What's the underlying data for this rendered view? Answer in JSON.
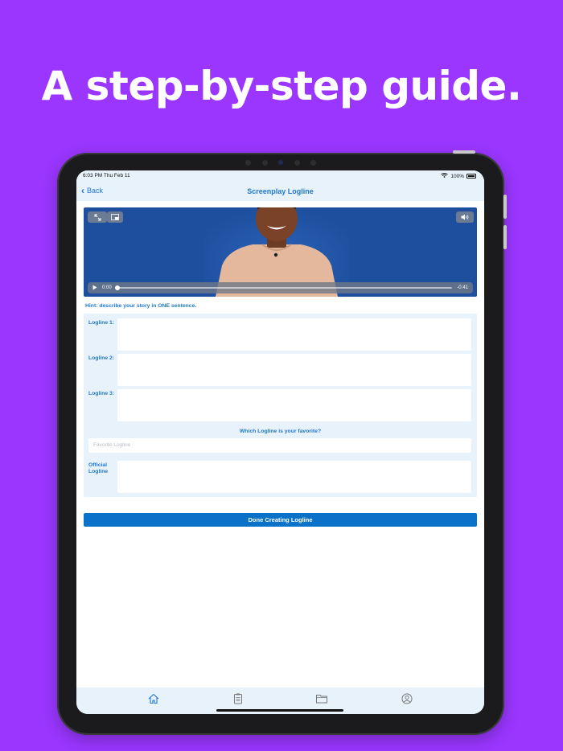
{
  "headline": "A step-by-step guide.",
  "status_bar": {
    "time": "6:03 PM  Thu Feb 11",
    "battery": "100%"
  },
  "nav": {
    "back_label": "Back",
    "title": "Screenplay Logline"
  },
  "video": {
    "current_time": "0:00",
    "remaining_time": "-0:41",
    "progress": 0.0
  },
  "hint": "Hint: describe your story in ONE sentence.",
  "form": {
    "logline_1_label": "Logline 1:",
    "logline_2_label": "Logline 2:",
    "logline_3_label": "Logline 3:",
    "favorite_question": "Which Logline is your favorite?",
    "favorite_placeholder": "Favorite Logline",
    "official_label_line1": "Official",
    "official_label_line2": "Logline"
  },
  "done_button": "Done Creating Logline",
  "tabbar": {
    "items": [
      "home-icon",
      "clipboard-icon",
      "folder-icon",
      "profile-icon"
    ]
  },
  "colors": {
    "background": "#9a36ff",
    "accent": "#1f78d1",
    "button": "#0a73c9",
    "panel": "#e8f2fb"
  }
}
